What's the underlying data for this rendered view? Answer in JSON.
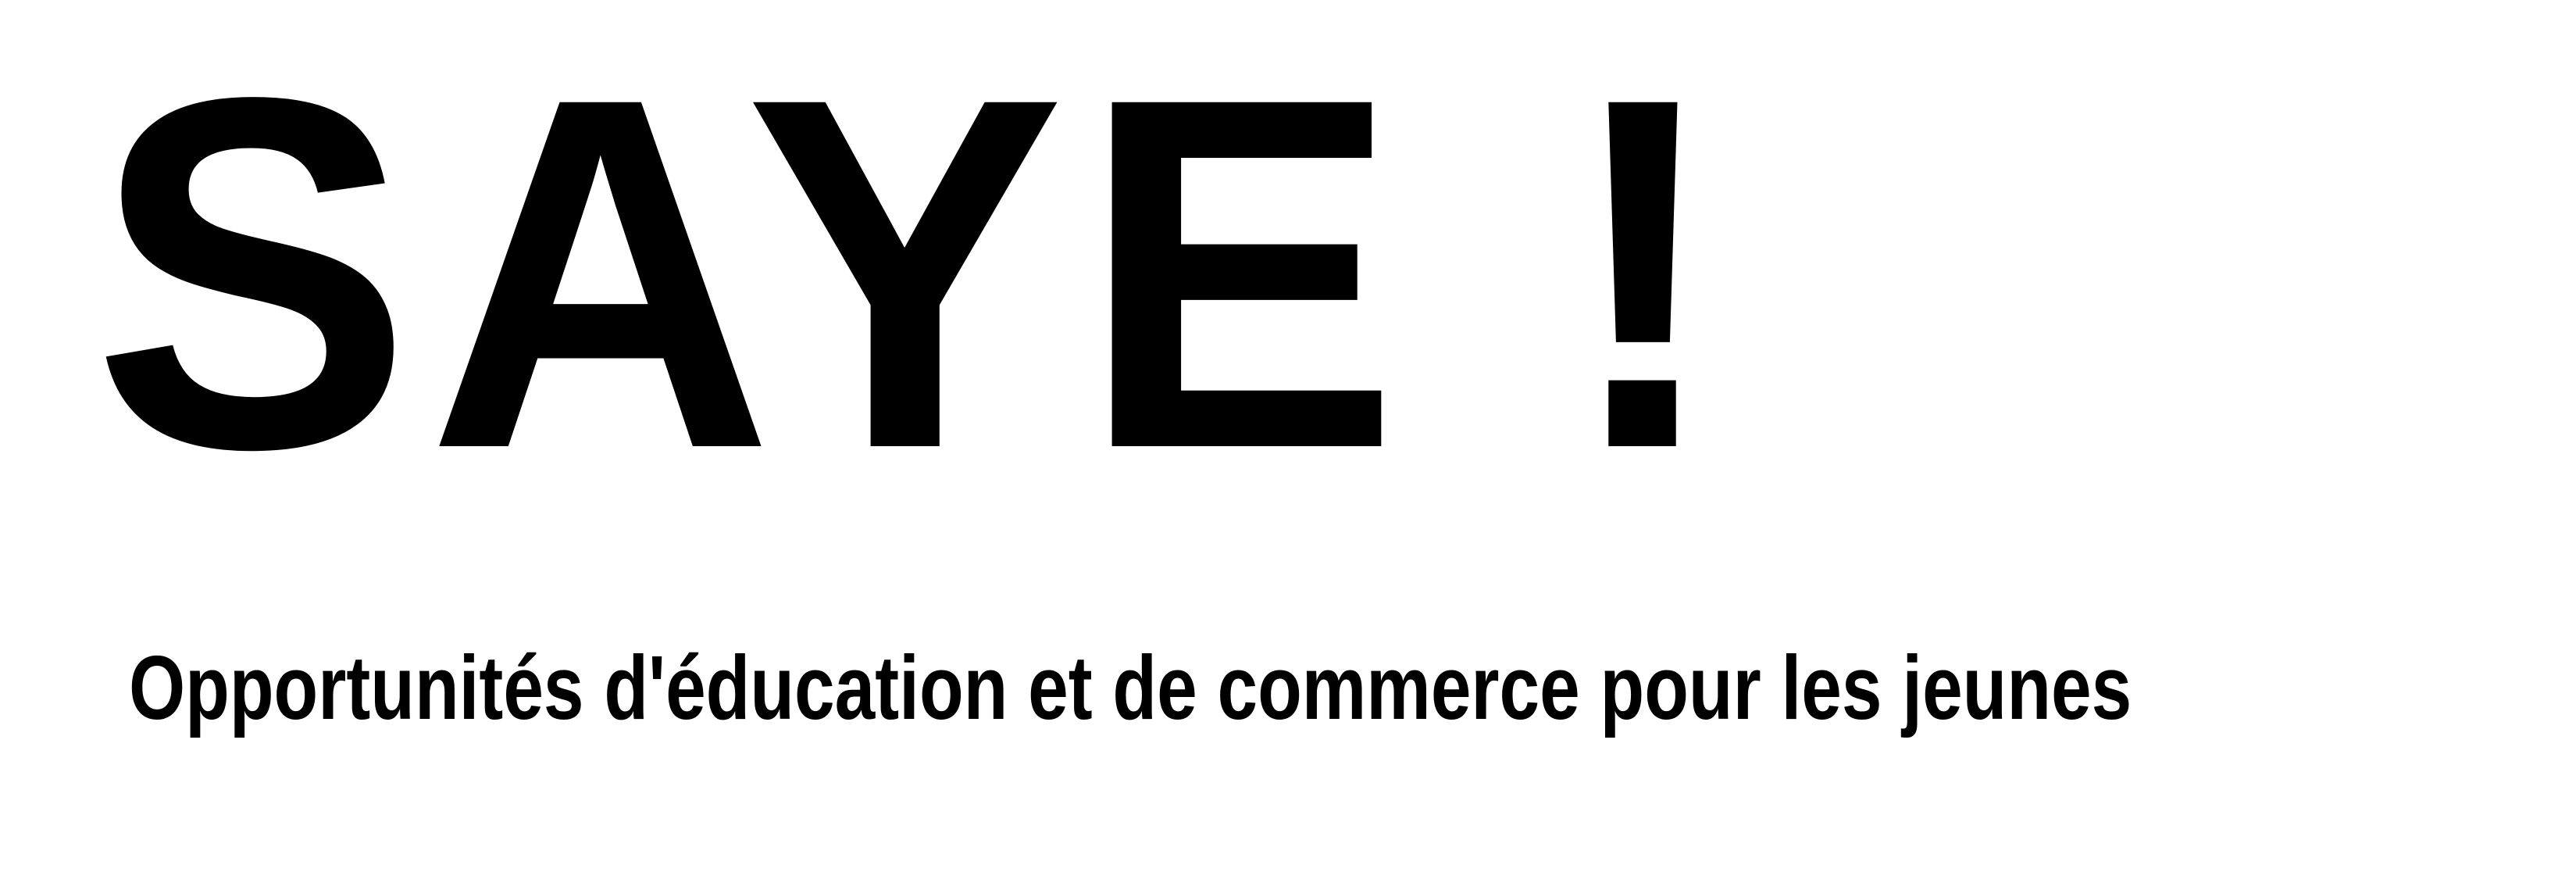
{
  "logo": {
    "text": "SAYE !"
  },
  "tagline": {
    "text": "Opportunités d'éducation et de commerce pour les jeunes"
  },
  "colors": {
    "background": "#ffffff",
    "text": "#000000"
  }
}
